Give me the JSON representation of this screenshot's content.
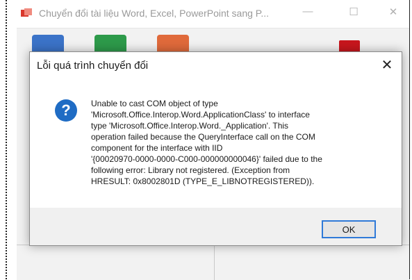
{
  "background_window": {
    "title": "Chuyển đổi tài liệu Word, Excel, PowerPoint sang P...",
    "minimize_glyph": "—",
    "maximize_glyph": "☐",
    "close_glyph": "✕",
    "icons": [
      "word-icon",
      "excel-icon",
      "powerpoint-icon",
      "pdf-icon"
    ]
  },
  "dialog": {
    "title": "Lỗi quá trình chuyển đổi",
    "close_glyph": "✕",
    "icon": "question-icon",
    "icon_glyph": "?",
    "message_lines": [
      "Unable to cast COM object of type",
      "'Microsoft.Office.Interop.Word.ApplicationClass' to interface",
      "type 'Microsoft.Office.Interop.Word._Application'. This",
      "operation failed because the QueryInterface call on the COM",
      "component for the interface with IID",
      "'{00020970-0000-0000-C000-000000000046}' failed due to the",
      "following error: Library not registered. (Exception from",
      "HRESULT: 0x8002801D (TYPE_E_LIBNOTREGISTERED))."
    ],
    "ok_label": "OK"
  },
  "colors": {
    "accent": "#2f7ad8",
    "question_icon": "#1f6cc4"
  }
}
